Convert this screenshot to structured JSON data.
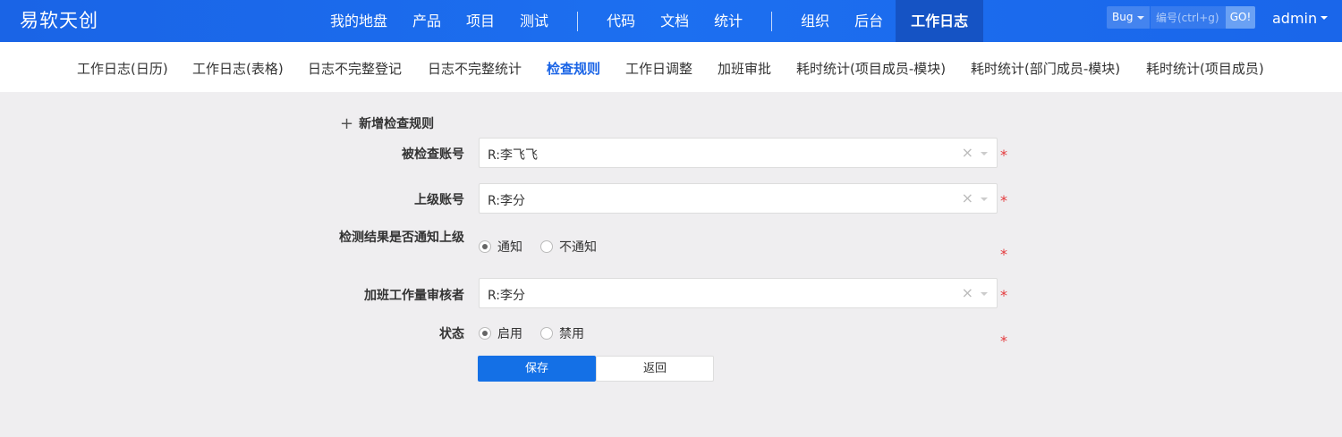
{
  "header": {
    "brand": "易软天创",
    "nav": [
      "我的地盘",
      "产品",
      "项目",
      "测试",
      "代码",
      "文档",
      "统计",
      "组织",
      "后台",
      "工作日志"
    ],
    "search": {
      "type": "Bug",
      "placeholder": "编号(ctrl+g)",
      "go": "GO!"
    },
    "user": "admin"
  },
  "subnav": [
    "工作日志(日历)",
    "工作日志(表格)",
    "日志不完整登记",
    "日志不完整统计",
    "检查规则",
    "工作日调整",
    "加班审批",
    "耗时统计(项目成员-模块)",
    "耗时统计(部门成员-模块)",
    "耗时统计(项目成员)"
  ],
  "form": {
    "title": "新增检查规则",
    "plus": "+",
    "checked_account": {
      "label": "被检查账号",
      "value": "R:李飞飞"
    },
    "superior_account": {
      "label": "上级账号",
      "value": "R:李分"
    },
    "notify": {
      "label": "检测结果是否通知上级",
      "options": [
        "通知",
        "不通知"
      ]
    },
    "overtime_reviewer": {
      "label": "加班工作量审核者",
      "value": "R:李分"
    },
    "status": {
      "label": "状态",
      "options": [
        "启用",
        "禁用"
      ]
    },
    "required_mark": "*",
    "clear_glyph": "×",
    "save": "保存",
    "back": "返回"
  }
}
